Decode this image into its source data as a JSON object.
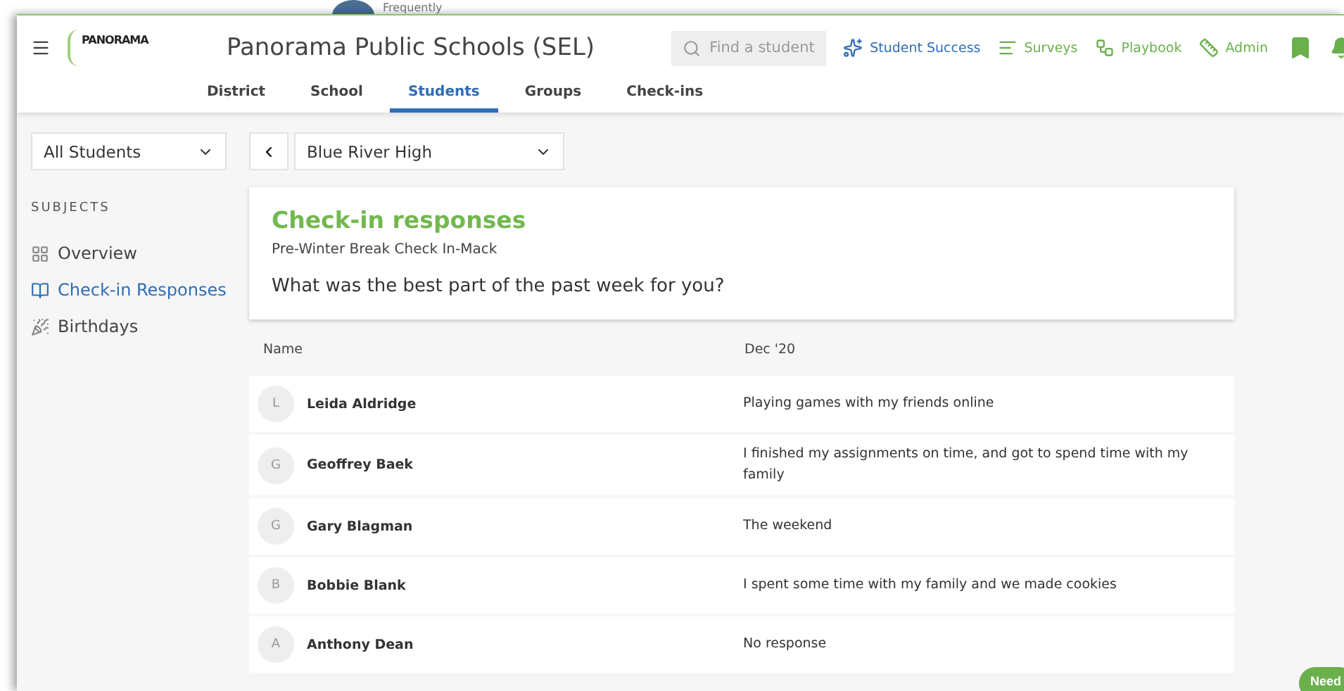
{
  "backdrop": {
    "caption": "Frequently"
  },
  "header": {
    "brand": "PANORAMA",
    "title": "Panorama Public Schools (SEL)",
    "search": {
      "placeholder": "Find a student"
    },
    "nav_links": [
      {
        "kind": "star",
        "label": "Student Success",
        "color": "#2f6db5"
      },
      {
        "kind": "lines",
        "label": "Surveys",
        "color": "#6ab04c"
      },
      {
        "kind": "play",
        "label": "Playbook",
        "color": "#6ab04c"
      },
      {
        "kind": "ruler",
        "label": "Admin",
        "color": "#6ab04c"
      }
    ],
    "tabs": [
      {
        "label": "District",
        "selected": false
      },
      {
        "label": "School",
        "selected": false
      },
      {
        "label": "Students",
        "selected": true
      },
      {
        "label": "Groups",
        "selected": false
      },
      {
        "label": "Check-ins",
        "selected": false
      }
    ]
  },
  "sidebar": {
    "filter": "All Students",
    "heading": "SUBJECTS",
    "items": [
      {
        "kind": "grid",
        "label": "Overview",
        "selected": false
      },
      {
        "kind": "book",
        "label": "Check-in Responses",
        "selected": true
      },
      {
        "kind": "hat",
        "label": "Birthdays",
        "selected": false
      }
    ]
  },
  "school_select": "Blue River High",
  "card": {
    "title": "Check-in responses",
    "subtitle": "Pre-Winter Break Check In-Mack",
    "question": "What was the best part of the past week for you?"
  },
  "table": {
    "columns": [
      "Name",
      "Dec '20"
    ],
    "rows": [
      {
        "initial": "L",
        "name": "Leida Aldridge",
        "response": "Playing games with my friends online"
      },
      {
        "initial": "G",
        "name": "Geoffrey Baek",
        "response": "I finished my assignments on time, and got to spend time with my family"
      },
      {
        "initial": "G",
        "name": "Gary Blagman",
        "response": "The weekend"
      },
      {
        "initial": "B",
        "name": "Bobbie Blank",
        "response": "I spent some time with my family and we made cookies"
      },
      {
        "initial": "A",
        "name": "Anthony Dean",
        "response": "No response"
      }
    ]
  },
  "help_button": "Need"
}
